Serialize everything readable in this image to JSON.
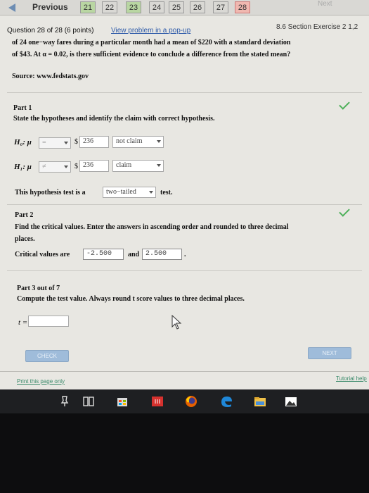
{
  "nav": {
    "previous_label": "Previous",
    "next_label": "Next",
    "questions": [
      "21",
      "22",
      "23",
      "24",
      "25",
      "26",
      "27",
      "28"
    ]
  },
  "header": {
    "question_label": "Question 28 of 28 (6 points)",
    "popup_link": "View problem in a pop-up",
    "section": "8.6 Section Exercise 2 1,2"
  },
  "problem": {
    "line1": "of 24 one−way fares during a particular month had a mean of $220 with a standard deviation",
    "line2": "of $43. At α = 0.02, is there sufficient evidence to conclude a difference from the stated mean?",
    "source": "Source: www.fedstats.gov"
  },
  "part1": {
    "title": "Part 1",
    "instruction": "State the hypotheses and identify the claim with correct hypothesis.",
    "h0_label": "H₀: μ",
    "h0_symbol": "=",
    "h0_currency": "$",
    "h0_value": "236",
    "h0_claim": "not claim",
    "h1_label": "H₁: μ",
    "h1_symbol": "≠",
    "h1_currency": "$",
    "h1_value": "236",
    "h1_claim": "claim",
    "test_prefix": "This hypothesis test is a",
    "test_type": "two−tailed",
    "test_suffix": "test."
  },
  "part2": {
    "title": "Part 2",
    "instruction_line1": "Find the critical values. Enter the answers in ascending order and rounded to three decimal",
    "instruction_line2": "places.",
    "crit_prefix": "Critical values are",
    "crit_value1": "-2.500",
    "crit_and": "and",
    "crit_value2": "2.500",
    "crit_suffix": "."
  },
  "part3": {
    "title": "Part 3 out of 7",
    "instruction": "Compute the test value. Always round t score values to three decimal places.",
    "t_label": "t =",
    "t_value": ""
  },
  "buttons": {
    "check": "CHECK",
    "next": "NEXT"
  },
  "footer": {
    "print_link": "Print this page only",
    "tutorial_link": "Tutorial help"
  },
  "colors": {
    "check_green": "#4eb05a",
    "link_blue": "#2c59a8",
    "current_question": "#f0b8b0",
    "answered_question": "#b9d6a2"
  },
  "taskbar_icons": [
    "pin-icon",
    "task-view-icon",
    "store-icon",
    "app-red-icon",
    "firefox-icon",
    "edge-icon",
    "file-explorer-icon",
    "photos-icon"
  ]
}
